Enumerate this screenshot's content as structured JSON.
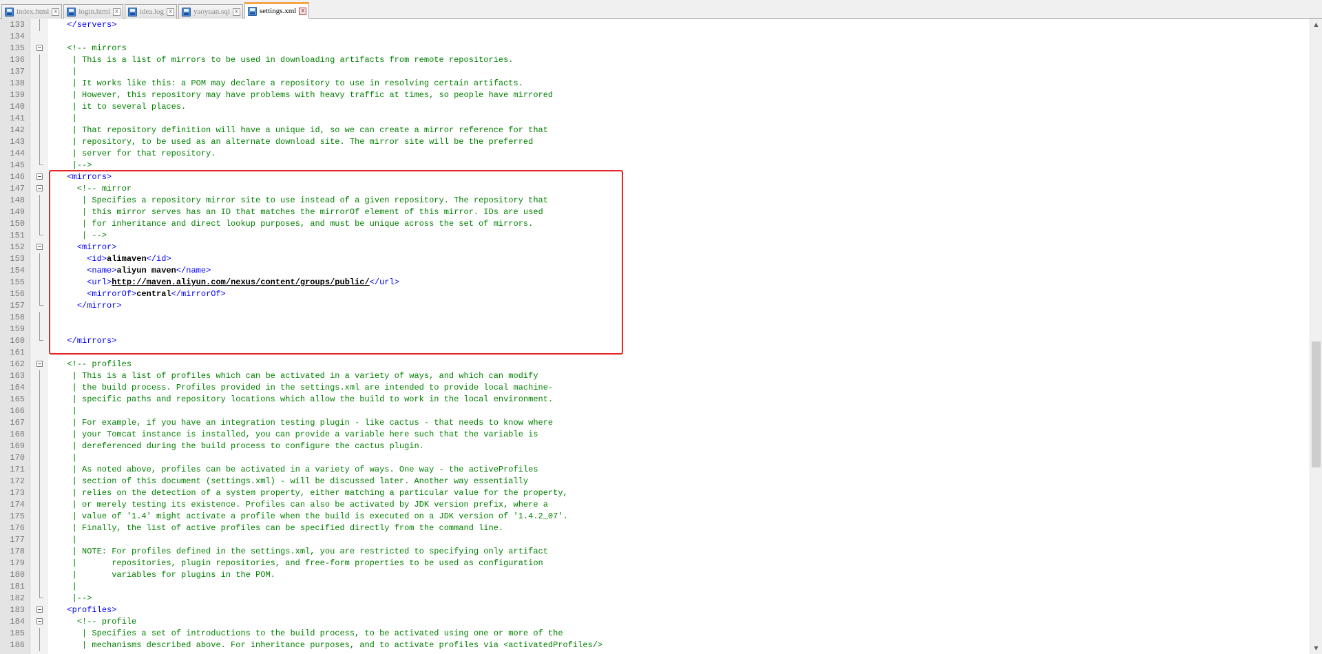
{
  "tabs": [
    {
      "label": "index.html",
      "active": false
    },
    {
      "label": "login.html",
      "active": false
    },
    {
      "label": "idea.log",
      "active": false
    },
    {
      "label": "yaoyuan.sql",
      "active": false
    },
    {
      "label": "settings.xml",
      "active": true
    }
  ],
  "tab_close_glyph": "x",
  "colors": {
    "comment": "#008000",
    "tag": "#0000ff",
    "text": "#000000",
    "highlight_box": "#e82424",
    "active_tab_accent": "#f8a54a"
  },
  "icons": {
    "tab": "document-icon",
    "fold": "fold-collapse-icon",
    "tab_close": "close-icon"
  },
  "scrollbar": {
    "up": "▲",
    "down": "▼"
  },
  "editor_lines": [
    {
      "n": "133",
      "fold": "line",
      "tokens": [
        {
          "t": "  "
        },
        {
          "t": "</servers>",
          "c": "tg"
        }
      ]
    },
    {
      "n": "134",
      "fold": "",
      "tokens": []
    },
    {
      "n": "135",
      "fold": "box",
      "tokens": [
        {
          "t": "  "
        },
        {
          "t": "<!-- mirrors",
          "c": "cm"
        }
      ]
    },
    {
      "n": "136",
      "fold": "line",
      "tokens": [
        {
          "t": "   | This is a list of mirrors to be used in downloading artifacts from remote repositories.",
          "c": "cm"
        }
      ]
    },
    {
      "n": "137",
      "fold": "line",
      "tokens": [
        {
          "t": "   |",
          "c": "cm"
        }
      ]
    },
    {
      "n": "138",
      "fold": "line",
      "tokens": [
        {
          "t": "   | It works like this: a POM may declare a repository to use in resolving certain artifacts.",
          "c": "cm"
        }
      ]
    },
    {
      "n": "139",
      "fold": "line",
      "tokens": [
        {
          "t": "   | However, this repository may have problems with heavy traffic at times, so people have mirrored",
          "c": "cm"
        }
      ]
    },
    {
      "n": "140",
      "fold": "line",
      "tokens": [
        {
          "t": "   | it to several places.",
          "c": "cm"
        }
      ]
    },
    {
      "n": "141",
      "fold": "line",
      "tokens": [
        {
          "t": "   |",
          "c": "cm"
        }
      ]
    },
    {
      "n": "142",
      "fold": "line",
      "tokens": [
        {
          "t": "   | That repository definition will have a unique id, so we can create a mirror reference for that",
          "c": "cm"
        }
      ]
    },
    {
      "n": "143",
      "fold": "line",
      "tokens": [
        {
          "t": "   | repository, to be used as an alternate download site. The mirror site will be the preferred",
          "c": "cm"
        }
      ]
    },
    {
      "n": "144",
      "fold": "line",
      "tokens": [
        {
          "t": "   | server for that repository.",
          "c": "cm"
        }
      ]
    },
    {
      "n": "145",
      "fold": "end",
      "tokens": [
        {
          "t": "   |-->",
          "c": "cm"
        }
      ]
    },
    {
      "n": "146",
      "fold": "box",
      "tokens": [
        {
          "t": "  "
        },
        {
          "t": "<mirrors>",
          "c": "tg"
        }
      ]
    },
    {
      "n": "147",
      "fold": "box",
      "tokens": [
        {
          "t": "    "
        },
        {
          "t": "<!-- mirror",
          "c": "cm"
        }
      ]
    },
    {
      "n": "148",
      "fold": "line",
      "tokens": [
        {
          "t": "     | Specifies a repository mirror site to use instead of a given repository. The repository that",
          "c": "cm"
        }
      ]
    },
    {
      "n": "149",
      "fold": "line",
      "tokens": [
        {
          "t": "     | this mirror serves has an ID that matches the mirrorOf element of this mirror. IDs are used",
          "c": "cm"
        }
      ]
    },
    {
      "n": "150",
      "fold": "line",
      "tokens": [
        {
          "t": "     | for inheritance and direct lookup purposes, and must be unique across the set of mirrors.",
          "c": "cm"
        }
      ]
    },
    {
      "n": "151",
      "fold": "end",
      "tokens": [
        {
          "t": "     | -->",
          "c": "cm"
        }
      ]
    },
    {
      "n": "152",
      "fold": "box",
      "tokens": [
        {
          "t": "    "
        },
        {
          "t": "<mirror>",
          "c": "tg"
        }
      ]
    },
    {
      "n": "153",
      "fold": "line",
      "tokens": [
        {
          "t": "      "
        },
        {
          "t": "<id>",
          "c": "tg"
        },
        {
          "t": "alimaven",
          "c": "tx"
        },
        {
          "t": "</id>",
          "c": "tg"
        }
      ]
    },
    {
      "n": "154",
      "fold": "line",
      "tokens": [
        {
          "t": "      "
        },
        {
          "t": "<name>",
          "c": "tg"
        },
        {
          "t": "aliyun maven",
          "c": "tx"
        },
        {
          "t": "</name>",
          "c": "tg"
        }
      ]
    },
    {
      "n": "155",
      "fold": "line",
      "tokens": [
        {
          "t": "      "
        },
        {
          "t": "<url>",
          "c": "tg"
        },
        {
          "t": "http://maven.aliyun.com/nexus/content/groups/public/",
          "c": "url"
        },
        {
          "t": "</url>",
          "c": "tg"
        }
      ]
    },
    {
      "n": "156",
      "fold": "line",
      "tokens": [
        {
          "t": "      "
        },
        {
          "t": "<mirrorOf>",
          "c": "tg"
        },
        {
          "t": "central",
          "c": "tx"
        },
        {
          "t": "</mirrorOf>",
          "c": "tg"
        }
      ]
    },
    {
      "n": "157",
      "fold": "end",
      "tokens": [
        {
          "t": "    "
        },
        {
          "t": "</mirror>",
          "c": "tg"
        }
      ]
    },
    {
      "n": "158",
      "fold": "line",
      "tokens": []
    },
    {
      "n": "159",
      "fold": "line",
      "tokens": []
    },
    {
      "n": "160",
      "fold": "end",
      "tokens": [
        {
          "t": "  "
        },
        {
          "t": "</mirrors>",
          "c": "tg"
        }
      ]
    },
    {
      "n": "161",
      "fold": "",
      "tokens": []
    },
    {
      "n": "162",
      "fold": "box",
      "tokens": [
        {
          "t": "  "
        },
        {
          "t": "<!-- profiles",
          "c": "cm"
        }
      ]
    },
    {
      "n": "163",
      "fold": "line",
      "tokens": [
        {
          "t": "   | This is a list of profiles which can be activated in a variety of ways, and which can modify",
          "c": "cm"
        }
      ]
    },
    {
      "n": "164",
      "fold": "line",
      "tokens": [
        {
          "t": "   | the build process. Profiles provided in the settings.xml are intended to provide local machine-",
          "c": "cm"
        }
      ]
    },
    {
      "n": "165",
      "fold": "line",
      "tokens": [
        {
          "t": "   | specific paths and repository locations which allow the build to work in the local environment.",
          "c": "cm"
        }
      ]
    },
    {
      "n": "166",
      "fold": "line",
      "tokens": [
        {
          "t": "   |",
          "c": "cm"
        }
      ]
    },
    {
      "n": "167",
      "fold": "line",
      "tokens": [
        {
          "t": "   | For example, if you have an integration testing plugin - like cactus - that needs to know where",
          "c": "cm"
        }
      ]
    },
    {
      "n": "168",
      "fold": "line",
      "tokens": [
        {
          "t": "   | your Tomcat instance is installed, you can provide a variable here such that the variable is",
          "c": "cm"
        }
      ]
    },
    {
      "n": "169",
      "fold": "line",
      "tokens": [
        {
          "t": "   | dereferenced during the build process to configure the cactus plugin.",
          "c": "cm"
        }
      ]
    },
    {
      "n": "170",
      "fold": "line",
      "tokens": [
        {
          "t": "   |",
          "c": "cm"
        }
      ]
    },
    {
      "n": "171",
      "fold": "line",
      "tokens": [
        {
          "t": "   | As noted above, profiles can be activated in a variety of ways. One way - the activeProfiles",
          "c": "cm"
        }
      ]
    },
    {
      "n": "172",
      "fold": "line",
      "tokens": [
        {
          "t": "   | section of this document (settings.xml) - will be discussed later. Another way essentially",
          "c": "cm"
        }
      ]
    },
    {
      "n": "173",
      "fold": "line",
      "tokens": [
        {
          "t": "   | relies on the detection of a system property, either matching a particular value for the property,",
          "c": "cm"
        }
      ]
    },
    {
      "n": "174",
      "fold": "line",
      "tokens": [
        {
          "t": "   | or merely testing its existence. Profiles can also be activated by JDK version prefix, where a",
          "c": "cm"
        }
      ]
    },
    {
      "n": "175",
      "fold": "line",
      "tokens": [
        {
          "t": "   | value of '1.4' might activate a profile when the build is executed on a JDK version of '1.4.2_07'.",
          "c": "cm"
        }
      ]
    },
    {
      "n": "176",
      "fold": "line",
      "tokens": [
        {
          "t": "   | Finally, the list of active profiles can be specified directly from the command line.",
          "c": "cm"
        }
      ]
    },
    {
      "n": "177",
      "fold": "line",
      "tokens": [
        {
          "t": "   |",
          "c": "cm"
        }
      ]
    },
    {
      "n": "178",
      "fold": "line",
      "tokens": [
        {
          "t": "   | NOTE: For profiles defined in the settings.xml, you are restricted to specifying only artifact",
          "c": "cm"
        }
      ]
    },
    {
      "n": "179",
      "fold": "line",
      "tokens": [
        {
          "t": "   |       repositories, plugin repositories, and free-form properties to be used as configuration",
          "c": "cm"
        }
      ]
    },
    {
      "n": "180",
      "fold": "line",
      "tokens": [
        {
          "t": "   |       variables for plugins in the POM.",
          "c": "cm"
        }
      ]
    },
    {
      "n": "181",
      "fold": "line",
      "tokens": [
        {
          "t": "   |",
          "c": "cm"
        }
      ]
    },
    {
      "n": "182",
      "fold": "end",
      "tokens": [
        {
          "t": "   |-->",
          "c": "cm"
        }
      ]
    },
    {
      "n": "183",
      "fold": "box",
      "tokens": [
        {
          "t": "  "
        },
        {
          "t": "<profiles>",
          "c": "tg"
        }
      ]
    },
    {
      "n": "184",
      "fold": "box",
      "tokens": [
        {
          "t": "    "
        },
        {
          "t": "<!-- profile",
          "c": "cm"
        }
      ]
    },
    {
      "n": "185",
      "fold": "line",
      "tokens": [
        {
          "t": "     | Specifies a set of introductions to the build process, to be activated using one or more of the",
          "c": "cm"
        }
      ]
    },
    {
      "n": "186",
      "fold": "line",
      "tokens": [
        {
          "t": "     | mechanisms described above. For inheritance purposes, and to activate profiles via <activatedProfiles/>",
          "c": "cm"
        }
      ]
    }
  ]
}
